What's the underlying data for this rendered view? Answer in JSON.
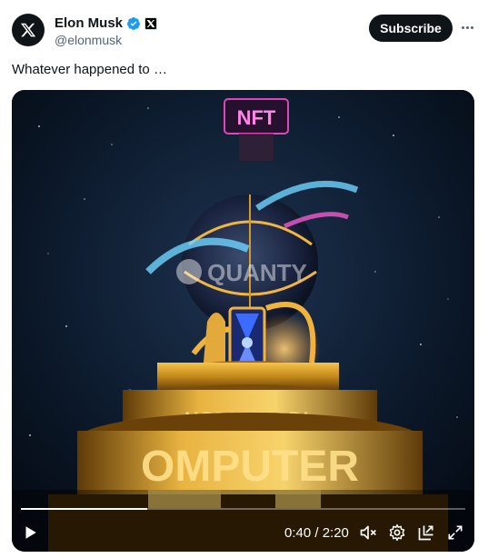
{
  "author": {
    "display_name": "Elon Musk",
    "handle": "@elonmusk",
    "avatar_icon": "x-logo-icon",
    "verified_icon": "verified-badge-icon",
    "affiliation_icon": "x-affiliate-badge-icon"
  },
  "header": {
    "subscribe_label": "Subscribe",
    "more_icon": "more-options-icon"
  },
  "tweet": {
    "text": "Whatever happened to …"
  },
  "video": {
    "progress_fraction": 0.285,
    "time_display": "0:40 / 2:20",
    "controls": [
      "play-icon",
      "mute-icon",
      "settings-icon",
      "pip-icon",
      "fullscreen-icon"
    ],
    "overlay_sign_text": "NFT",
    "watermark_text": "QUANTY"
  },
  "colors": {
    "text_primary": "#0f1419",
    "text_secondary": "#536471",
    "verified_blue": "#1d9bf0",
    "button_bg": "#0f1419",
    "video_bg": "#0a1624"
  }
}
